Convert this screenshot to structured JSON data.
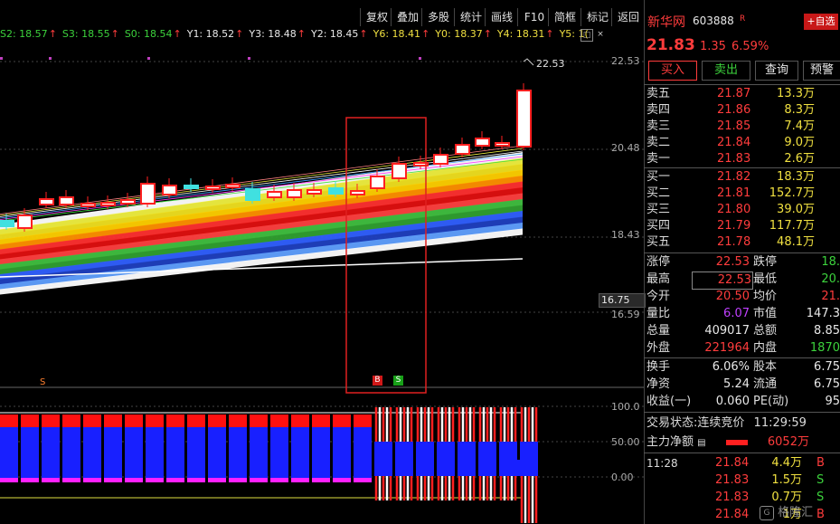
{
  "toolbar": {
    "buttons": [
      "复权",
      "叠加",
      "多股",
      "统计",
      "画线",
      "F10",
      "简框",
      "标记",
      "返回"
    ],
    "close_icon": "close-icon",
    "maximize_icon": "maximize-icon"
  },
  "ma_line": [
    {
      "label": "S2: 18.57",
      "color": "#3cd23c"
    },
    {
      "label": "S3: 18.55",
      "color": "#3cd23c"
    },
    {
      "label": "S0: 18.54",
      "color": "#3cd23c"
    },
    {
      "label": "Y1: 18.52",
      "color": "#e8e8e8"
    },
    {
      "label": "Y3: 18.48",
      "color": "#e8e8e8"
    },
    {
      "label": "Y2: 18.45",
      "color": "#e8e8e8"
    },
    {
      "label": "Y6: 18.41",
      "color": "#f0e040"
    },
    {
      "label": "Y0: 18.37",
      "color": "#f0e040"
    },
    {
      "label": "Y4: 18.31",
      "color": "#f0e040"
    },
    {
      "label": "Y5: 1(",
      "color": "#f0e040"
    }
  ],
  "price_axis": {
    "p1": "22.53",
    "p2": "20.48",
    "p3": "18.43",
    "p4": "16.59",
    "current_tag": "16.75"
  },
  "high_marker": "22.53",
  "signals": {
    "s_marker": "S",
    "buy": "B",
    "sell": "S"
  },
  "indicator_axis": {
    "t100": "100.0",
    "t50": "50.00",
    "t0": "0.00"
  },
  "stock": {
    "name": "新华网",
    "code": "603888",
    "badge": "R",
    "add_button": "+自选",
    "price": "21.83",
    "change": "1.35",
    "pct": "6.59%"
  },
  "actions": [
    "买入",
    "卖出",
    "查询",
    "预警"
  ],
  "orderbook": {
    "sells": [
      {
        "label": "卖五",
        "price": "21.87",
        "vol": "13.3万"
      },
      {
        "label": "卖四",
        "price": "21.86",
        "vol": "8.3万"
      },
      {
        "label": "卖三",
        "price": "21.85",
        "vol": "7.4万"
      },
      {
        "label": "卖二",
        "price": "21.84",
        "vol": "9.0万"
      },
      {
        "label": "卖一",
        "price": "21.83",
        "vol": "2.6万"
      }
    ],
    "buys": [
      {
        "label": "买一",
        "price": "21.82",
        "vol": "18.3万"
      },
      {
        "label": "买二",
        "price": "21.81",
        "vol": "152.7万"
      },
      {
        "label": "买三",
        "price": "21.80",
        "vol": "39.0万"
      },
      {
        "label": "买四",
        "price": "21.79",
        "vol": "117.7万"
      },
      {
        "label": "买五",
        "price": "21.78",
        "vol": "48.1万"
      }
    ]
  },
  "stats": [
    {
      "l1": "涨停",
      "v1": "22.53",
      "l2": "跌停",
      "v2": "18."
    },
    {
      "l1": "最高",
      "v1": "22.53",
      "l2": "最低",
      "v2": "20."
    },
    {
      "l1": "今开",
      "v1": "20.50",
      "l2": "均价",
      "v2": "21."
    },
    {
      "l1": "量比",
      "v1": "6.07",
      "l2": "市值",
      "v2": "147.3"
    },
    {
      "l1": "总量",
      "v1": "409017",
      "l2": "总额",
      "v2": "8.85"
    },
    {
      "l1": "外盘",
      "v1": "221964",
      "l2": "内盘",
      "v2": "1870"
    }
  ],
  "fund": [
    {
      "l1": "换手",
      "v1": "6.06%",
      "l2": "股本",
      "v2": "6.75"
    },
    {
      "l1": "净资",
      "v1": "5.24",
      "l2": "流通",
      "v2": "6.75"
    },
    {
      "l1": "收益(一)",
      "v1": "0.060",
      "l2": "PE(动)",
      "v2": "95"
    }
  ],
  "trade_status": {
    "label": "交易状态:",
    "value": "连续竞价",
    "time": "11:29:59"
  },
  "main_flow": {
    "label": "主力净额",
    "value": "6052万"
  },
  "ticks": [
    {
      "time": "11:28",
      "price": "21.84",
      "vol": "4.4万",
      "side": "B"
    },
    {
      "time": "",
      "price": "21.83",
      "vol": "1.5万",
      "side": "S"
    },
    {
      "time": "",
      "price": "21.83",
      "vol": "0.7万",
      "side": "S"
    },
    {
      "time": "",
      "price": "21.84",
      "vol": "1万",
      "side": "B"
    }
  ],
  "watermark": "格隆汇"
}
